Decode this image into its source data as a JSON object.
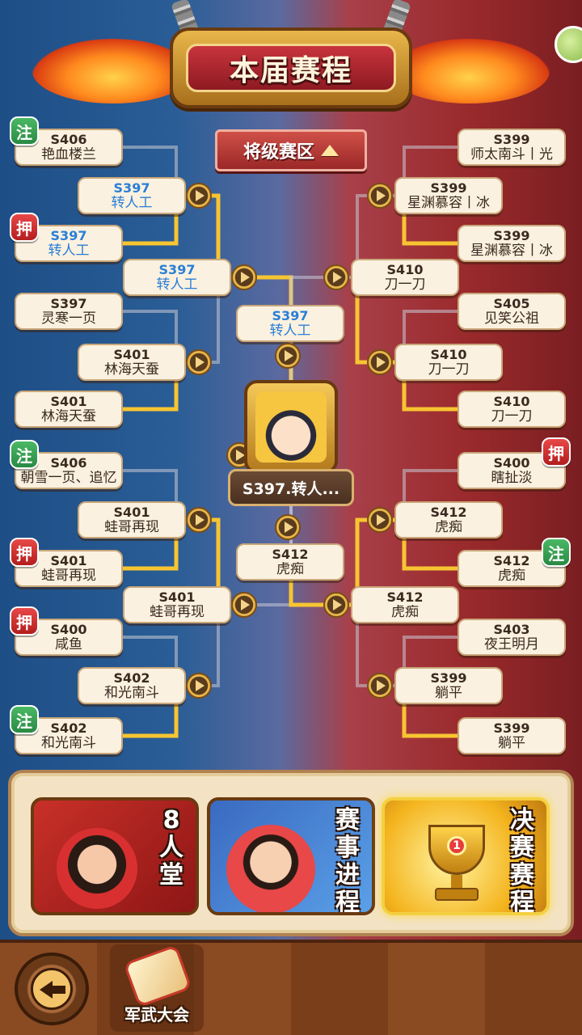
{
  "header": {
    "title": "本届赛程"
  },
  "division": {
    "label": "将级赛区"
  },
  "colors": {
    "highlight": "#2a7fd6",
    "active_line": "#f7c531",
    "inactive_line": "#c9c9d4"
  },
  "left": {
    "r1": [
      {
        "server": "S406",
        "name": "艳血楼兰"
      },
      {
        "server": "S397",
        "name": "转人工",
        "winner": true
      },
      {
        "server": "S397",
        "name": "灵寒一页"
      },
      {
        "server": "S401",
        "name": "林海天蚕"
      },
      {
        "server": "S406",
        "name": "朝雪一页、追忆"
      },
      {
        "server": "S401",
        "name": "蛙哥再现"
      },
      {
        "server": "S400",
        "name": "咸鱼"
      },
      {
        "server": "S402",
        "name": "和光南斗"
      }
    ],
    "r2": [
      {
        "server": "S397",
        "name": "转人工",
        "winner": true
      },
      {
        "server": "S401",
        "name": "林海天蚕"
      },
      {
        "server": "S401",
        "name": "蛙哥再现"
      },
      {
        "server": "S402",
        "name": "和光南斗"
      }
    ],
    "r3": [
      {
        "server": "S397",
        "name": "转人工",
        "winner": true
      },
      {
        "server": "S401",
        "name": "蛙哥再现"
      }
    ],
    "r4": [
      {
        "server": "S397",
        "name": "转人工",
        "winner": true
      }
    ]
  },
  "right": {
    "r1": [
      {
        "server": "S399",
        "name": "师太南斗丨光"
      },
      {
        "server": "S399",
        "name": "星渊慕容丨冰"
      },
      {
        "server": "S405",
        "name": "见笑公祖"
      },
      {
        "server": "S410",
        "name": "刀一刀"
      },
      {
        "server": "S400",
        "name": "瞎扯淡"
      },
      {
        "server": "S412",
        "name": "虎痴"
      },
      {
        "server": "S403",
        "name": "夜王明月"
      },
      {
        "server": "S399",
        "name": "躺平"
      }
    ],
    "r2": [
      {
        "server": "S399",
        "name": "星渊慕容丨冰"
      },
      {
        "server": "S410",
        "name": "刀一刀"
      },
      {
        "server": "S412",
        "name": "虎痴"
      },
      {
        "server": "S399",
        "name": "躺平"
      }
    ],
    "r3": [
      {
        "server": "S410",
        "name": "刀一刀"
      },
      {
        "server": "S412",
        "name": "虎痴"
      }
    ],
    "r4": [
      {
        "server": "S412",
        "name": "虎痴"
      }
    ]
  },
  "champion": {
    "label": "S397.转人..."
  },
  "badges": [
    {
      "text": "注",
      "color": "green"
    },
    {
      "text": "押",
      "color": "red"
    },
    {
      "text": "注",
      "color": "green"
    },
    {
      "text": "押",
      "color": "red"
    },
    {
      "text": "押",
      "color": "red"
    },
    {
      "text": "注",
      "color": "green"
    },
    {
      "text": "押",
      "color": "red"
    },
    {
      "text": "注",
      "color": "green"
    }
  ],
  "tabs": [
    {
      "label": "8人堂"
    },
    {
      "label": "赛事进程"
    },
    {
      "label": "决赛赛程",
      "active": true
    }
  ],
  "trophy_number": "1",
  "bottom": {
    "event_label": "军武大会"
  }
}
